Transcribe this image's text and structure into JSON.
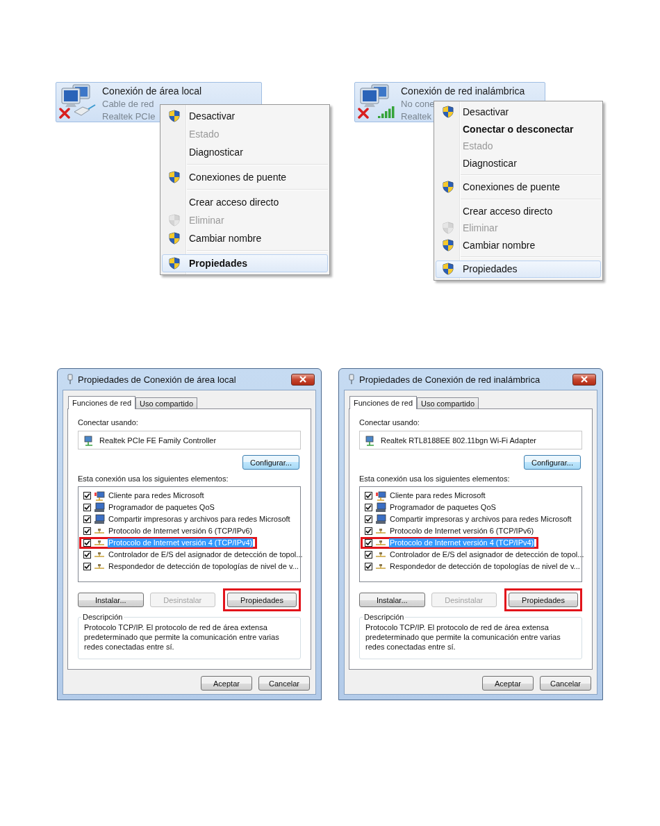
{
  "context_menus": [
    {
      "tile": {
        "kind": "wired",
        "title": "Conexión de área local",
        "lines": [
          "Cable de red",
          "Realtek PCIe"
        ]
      },
      "menu": [
        {
          "kind": "item",
          "label": "Desactivar",
          "shield": true,
          "disabled": false,
          "bold": false,
          "selected": false
        },
        {
          "kind": "item",
          "label": "Estado",
          "shield": false,
          "disabled": true,
          "bold": false,
          "selected": false
        },
        {
          "kind": "item",
          "label": "Diagnosticar",
          "shield": false,
          "disabled": false,
          "bold": false,
          "selected": false
        },
        {
          "kind": "separator"
        },
        {
          "kind": "item",
          "label": "Conexiones de puente",
          "shield": true,
          "disabled": false,
          "bold": false,
          "selected": false
        },
        {
          "kind": "separator"
        },
        {
          "kind": "item",
          "label": "Crear acceso directo",
          "shield": false,
          "disabled": false,
          "bold": false,
          "selected": false
        },
        {
          "kind": "item",
          "label": "Eliminar",
          "shield": true,
          "disabled": true,
          "bold": false,
          "selected": false
        },
        {
          "kind": "item",
          "label": "Cambiar nombre",
          "shield": true,
          "disabled": false,
          "bold": false,
          "selected": false
        },
        {
          "kind": "separator"
        },
        {
          "kind": "item",
          "label": "Propiedades",
          "shield": true,
          "disabled": false,
          "bold": true,
          "selected": true
        }
      ]
    },
    {
      "tile": {
        "kind": "wireless",
        "title": "Conexión de red inalámbrica",
        "lines": [
          "No cone",
          "Realtek"
        ]
      },
      "menu": [
        {
          "kind": "item",
          "label": "Desactivar",
          "shield": true,
          "disabled": false,
          "bold": false,
          "selected": false
        },
        {
          "kind": "item",
          "label": "Conectar o desconectar",
          "shield": false,
          "disabled": false,
          "bold": true,
          "selected": false
        },
        {
          "kind": "item",
          "label": "Estado",
          "shield": false,
          "disabled": true,
          "bold": false,
          "selected": false
        },
        {
          "kind": "item",
          "label": "Diagnosticar",
          "shield": false,
          "disabled": false,
          "bold": false,
          "selected": false
        },
        {
          "kind": "separator"
        },
        {
          "kind": "item",
          "label": "Conexiones de puente",
          "shield": true,
          "disabled": false,
          "bold": false,
          "selected": false
        },
        {
          "kind": "separator"
        },
        {
          "kind": "item",
          "label": "Crear acceso directo",
          "shield": false,
          "disabled": false,
          "bold": false,
          "selected": false
        },
        {
          "kind": "item",
          "label": "Eliminar",
          "shield": true,
          "disabled": true,
          "bold": false,
          "selected": false
        },
        {
          "kind": "item",
          "label": "Cambiar nombre",
          "shield": true,
          "disabled": false,
          "bold": false,
          "selected": false
        },
        {
          "kind": "separator"
        },
        {
          "kind": "item",
          "label": "Propiedades",
          "shield": true,
          "disabled": false,
          "bold": false,
          "selected": true
        }
      ]
    }
  ],
  "dialogs": [
    {
      "title": "Propiedades de Conexión de área local",
      "tabs": [
        {
          "label": "Funciones de red",
          "selected": true
        },
        {
          "label": "Uso compartido",
          "selected": false
        }
      ],
      "connect_label": "Conectar usando:",
      "adapter": "Realtek PCIe FE Family Controller",
      "configure_button": "Configurar...",
      "items_label": "Esta conexión usa los siguientes elementos:",
      "items": [
        {
          "kind": "client",
          "label": "Cliente para redes Microsoft",
          "checked": true,
          "selected": false,
          "highlighted": false
        },
        {
          "kind": "service",
          "label": "Programador de paquetes QoS",
          "checked": true,
          "selected": false,
          "highlighted": false
        },
        {
          "kind": "service",
          "label": "Compartir impresoras y archivos para redes Microsoft",
          "checked": true,
          "selected": false,
          "highlighted": false
        },
        {
          "kind": "protocol",
          "label": "Protocolo de Internet versión 6 (TCP/IPv6)",
          "checked": true,
          "selected": false,
          "highlighted": false
        },
        {
          "kind": "protocol",
          "label": "Protocolo de Internet versión 4 (TCP/IPv4)",
          "checked": true,
          "selected": true,
          "highlighted": true
        },
        {
          "kind": "protocol",
          "label": "Controlador de E/S del asignador de detección de topol...",
          "checked": true,
          "selected": false,
          "highlighted": false
        },
        {
          "kind": "protocol",
          "label": "Respondedor de detección de topologías de nivel de v...",
          "checked": true,
          "selected": false,
          "highlighted": false
        }
      ],
      "buttons": [
        {
          "label": "Instalar...",
          "disabled": false,
          "highlighted": false
        },
        {
          "label": "Desinstalar",
          "disabled": true,
          "highlighted": false
        },
        {
          "label": "Propiedades",
          "disabled": false,
          "highlighted": true
        }
      ],
      "description_title": "Descripción",
      "description": "Protocolo TCP/IP. El protocolo de red de área extensa predeterminado que permite la comunicación entre varias redes conectadas entre sí.",
      "footer_buttons": [
        "Aceptar",
        "Cancelar"
      ]
    },
    {
      "title": "Propiedades de Conexión de red inalámbrica",
      "tabs": [
        {
          "label": "Funciones de red",
          "selected": true
        },
        {
          "label": "Uso compartido",
          "selected": false
        }
      ],
      "connect_label": "Conectar usando:",
      "adapter": "Realtek RTL8188EE 802.11bgn Wi-Fi Adapter",
      "configure_button": "Configurar...",
      "items_label": "Esta conexión usa los siguientes elementos:",
      "items": [
        {
          "kind": "client",
          "label": "Cliente para redes Microsoft",
          "checked": true,
          "selected": false,
          "highlighted": false
        },
        {
          "kind": "service",
          "label": "Programador de paquetes QoS",
          "checked": true,
          "selected": false,
          "highlighted": false
        },
        {
          "kind": "service",
          "label": "Compartir impresoras y archivos para redes Microsoft",
          "checked": true,
          "selected": false,
          "highlighted": false
        },
        {
          "kind": "protocol",
          "label": "Protocolo de Internet versión 6 (TCP/IPv6)",
          "checked": true,
          "selected": false,
          "highlighted": false
        },
        {
          "kind": "protocol",
          "label": "Protocolo de Internet versión 4 (TCP/IPv4)",
          "checked": true,
          "selected": true,
          "highlighted": true
        },
        {
          "kind": "protocol",
          "label": "Controlador de E/S del asignador de detección de topol...",
          "checked": true,
          "selected": false,
          "highlighted": false
        },
        {
          "kind": "protocol",
          "label": "Respondedor de detección de topologías de nivel de v...",
          "checked": true,
          "selected": false,
          "highlighted": false
        }
      ],
      "buttons": [
        {
          "label": "Instalar...",
          "disabled": false,
          "highlighted": false
        },
        {
          "label": "Desinstalar",
          "disabled": true,
          "highlighted": false
        },
        {
          "label": "Propiedades",
          "disabled": false,
          "highlighted": true
        }
      ],
      "description_title": "Descripción",
      "description": "Protocolo TCP/IP. El protocolo de red de área extensa predeterminado que permite la comunicación entre varias redes conectadas entre sí.",
      "footer_buttons": [
        "Aceptar",
        "Cancelar"
      ]
    }
  ]
}
